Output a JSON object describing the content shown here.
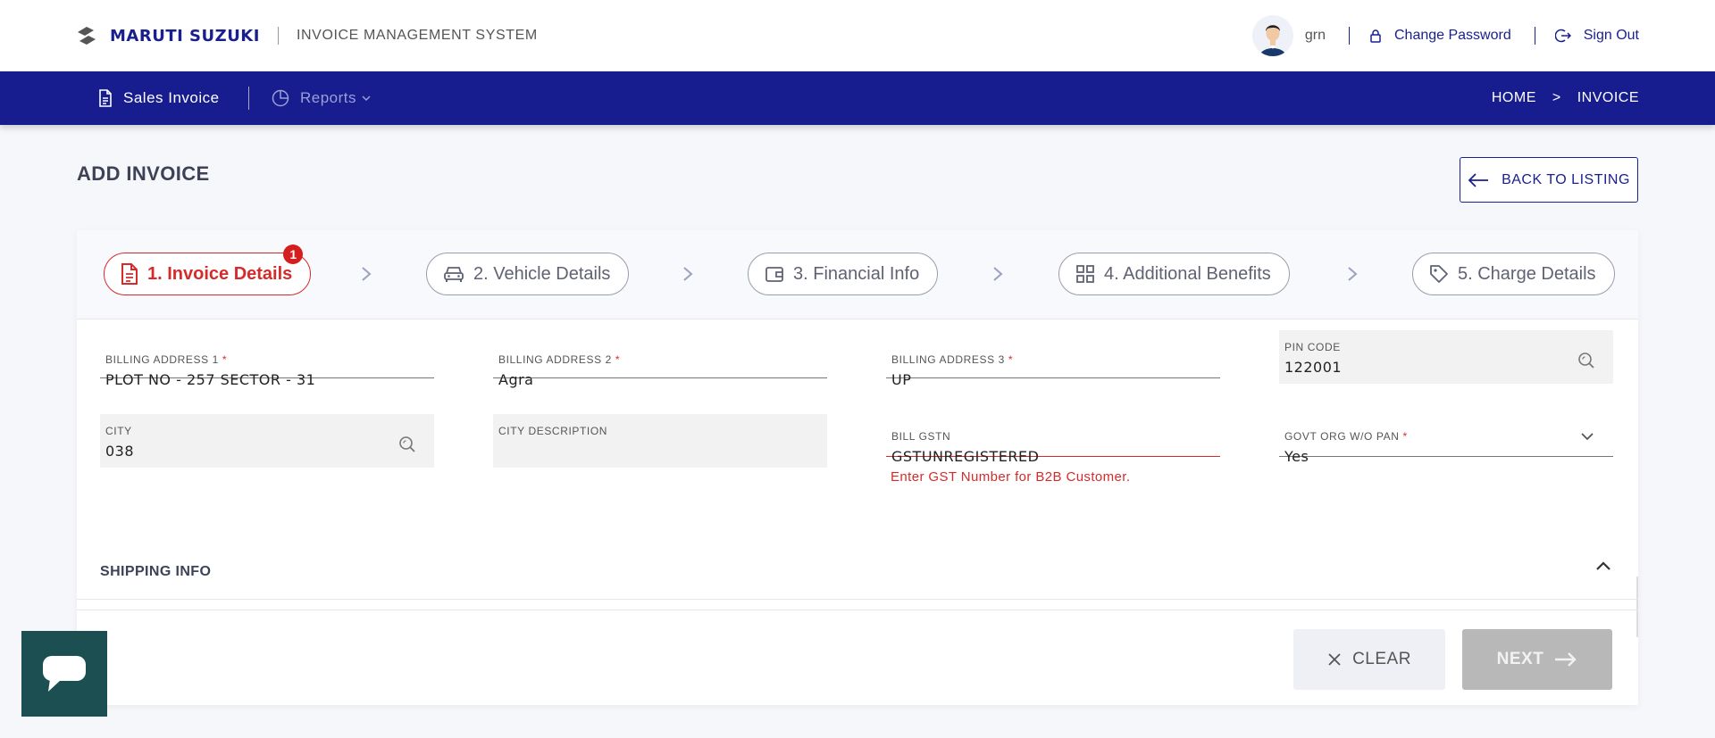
{
  "header": {
    "brand": "MARUTI SUZUKI",
    "app_title": "INVOICE MANAGEMENT SYSTEM",
    "user_name": "grn",
    "change_password": "Change Password",
    "sign_out": "Sign Out"
  },
  "nav": {
    "sales_invoice": "Sales Invoice",
    "reports": "Reports",
    "breadcrumb": {
      "home": "HOME",
      "separator": ">",
      "current": "INVOICE"
    }
  },
  "page": {
    "title": "ADD INVOICE",
    "back_button": "BACK TO LISTING"
  },
  "steps": [
    {
      "label": "1. Invoice Details",
      "active": true,
      "badge": "1"
    },
    {
      "label": "2. Vehicle Details",
      "active": false
    },
    {
      "label": "3. Financial Info",
      "active": false
    },
    {
      "label": "4. Additional Benefits",
      "active": false
    },
    {
      "label": "5. Charge Details",
      "active": false
    }
  ],
  "form": {
    "billing_address_1": {
      "label": "BILLING ADDRESS 1",
      "required": "*",
      "value": "PLOT NO - 257 SECTOR - 31"
    },
    "billing_address_2": {
      "label": "BILLING ADDRESS 2",
      "required": "*",
      "value": "Agra"
    },
    "billing_address_3": {
      "label": "BILLING ADDRESS 3",
      "required": "*",
      "value": "UP"
    },
    "pin_code": {
      "label": "PIN CODE",
      "value": "122001"
    },
    "city": {
      "label": "CITY",
      "value": "038"
    },
    "city_description": {
      "label": "CITY DESCRIPTION",
      "value": ""
    },
    "bill_gstn": {
      "label": "BILL GSTN",
      "value": "GSTUNREGISTERED",
      "error": "Enter GST Number for B2B Customer."
    },
    "govt_org": {
      "label": "GOVT ORG W/O PAN",
      "required": "*",
      "value": "Yes"
    }
  },
  "sections": {
    "shipping": "SHIPPING INFO"
  },
  "actions": {
    "clear": "CLEAR",
    "next": "NEXT"
  },
  "colors": {
    "brand_blue": "#171c8f",
    "error_red": "#d52b2b",
    "chat_teal": "#1c4f51"
  }
}
